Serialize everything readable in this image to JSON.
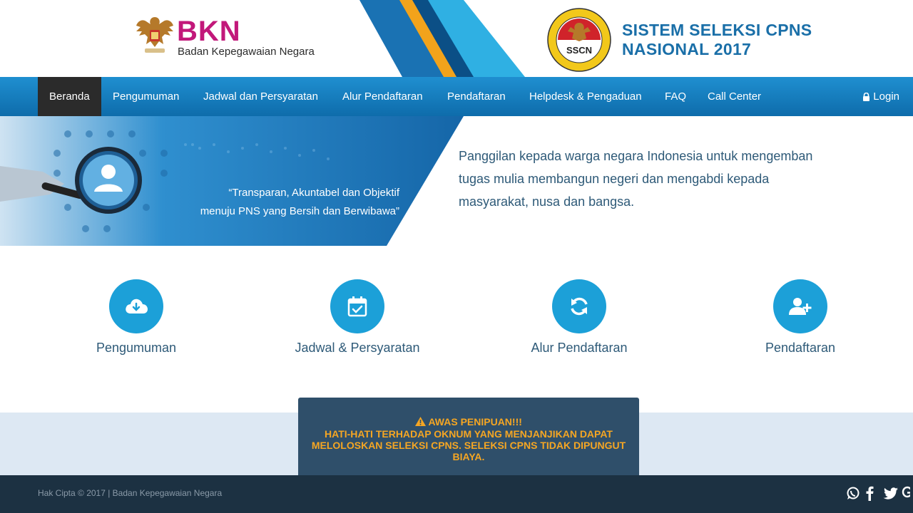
{
  "header": {
    "org_name": "BKN",
    "org_full_name": "Badan Kepegawaian Negara",
    "system_title_line1": "SISTEM SELEKSI CPNS",
    "system_title_line2": "NASIONAL 2017",
    "seal_text": "SSCN"
  },
  "nav": {
    "items": [
      {
        "label": "Beranda",
        "active": true
      },
      {
        "label": "Pengumuman"
      },
      {
        "label": "Jadwal dan Persyaratan"
      },
      {
        "label": "Alur Pendaftaran"
      },
      {
        "label": "Pendaftaran"
      },
      {
        "label": "Helpdesk & Pengaduan"
      },
      {
        "label": "FAQ"
      },
      {
        "label": "Call Center"
      }
    ],
    "login_label": "Login"
  },
  "banner": {
    "quote_line1": "“Transparan, Akuntabel dan Objektif",
    "quote_line2": "menuju PNS yang Bersih dan Berwibawa”",
    "text_line1": "Panggilan kepada warga negara Indonesia untuk mengemban",
    "text_line2": "tugas mulia membangun negeri dan mengabdi kepada",
    "text_line3": "masyarakat, nusa dan bangsa."
  },
  "features": [
    {
      "label": "Pengumuman",
      "icon": "cloud-download-icon"
    },
    {
      "label": "Jadwal & Persyaratan",
      "icon": "calendar-check-icon"
    },
    {
      "label": "Alur Pendaftaran",
      "icon": "refresh-icon"
    },
    {
      "label": "Pendaftaran",
      "icon": "user-plus-icon"
    }
  ],
  "warning": {
    "title": "AWAS PENIPUAN!!!",
    "line1": "HATI-HATI TERHADAP OKNUM YANG MENJANJIKAN DAPAT",
    "line2": "MELOLOSKAN SELEKSI CPNS. SELEKSI CPNS TIDAK DIPUNGUT",
    "line3": "BIAYA."
  },
  "footer": {
    "copyright": "Hak Cipta © 2017 | Badan Kepegawaian Negara"
  },
  "colors": {
    "nav_blue": "#1577bd",
    "accent_cyan": "#1ca0d8",
    "brand_magenta": "#c2187a",
    "warning_orange": "#f5a623",
    "footer_dark": "#1c3142"
  }
}
